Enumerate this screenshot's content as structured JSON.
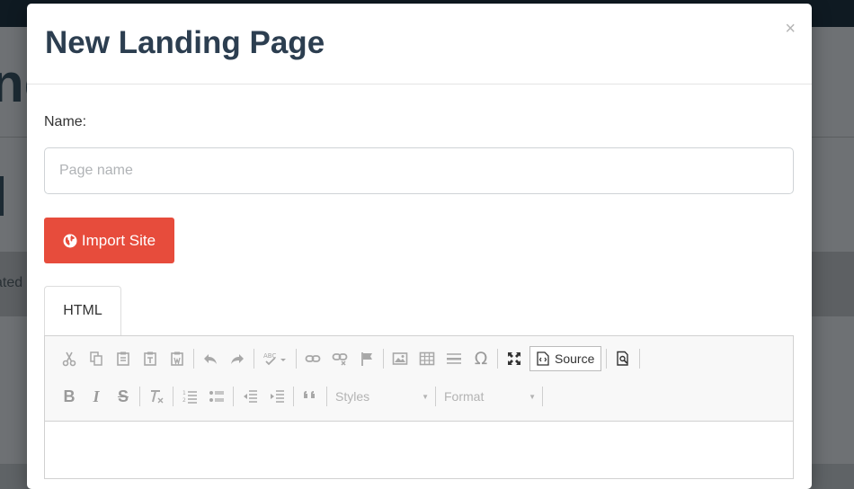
{
  "background": {
    "heading_fragment": "nc",
    "band_text_fragment": "ated"
  },
  "modal": {
    "title": "New Landing Page",
    "close_label": "×",
    "name_label": "Name:",
    "name_placeholder": "Page name",
    "name_value": "",
    "import_button_label": "Import Site",
    "tabs": [
      {
        "label": "HTML",
        "active": true
      }
    ],
    "toolbar": {
      "row1": [
        "cut",
        "copy",
        "paste",
        "paste-text",
        "paste-word",
        "undo",
        "redo",
        "spellcheck",
        "link",
        "unlink",
        "anchor",
        "image",
        "table",
        "horizontal-line",
        "special-char",
        "maximize",
        "source",
        "preview"
      ],
      "row2": [
        "bold",
        "italic",
        "strike",
        "remove-format",
        "numbered-list",
        "bulleted-list",
        "outdent",
        "indent",
        "blockquote",
        "styles",
        "format"
      ],
      "source_label": "Source",
      "bold_label": "B",
      "italic_label": "I",
      "strike_label": "S",
      "styles_label": "Styles",
      "format_label": "Format"
    }
  },
  "colors": {
    "accent_red": "#e74c3c",
    "title_color": "#2c3e50",
    "overlay": "#5f6366"
  }
}
